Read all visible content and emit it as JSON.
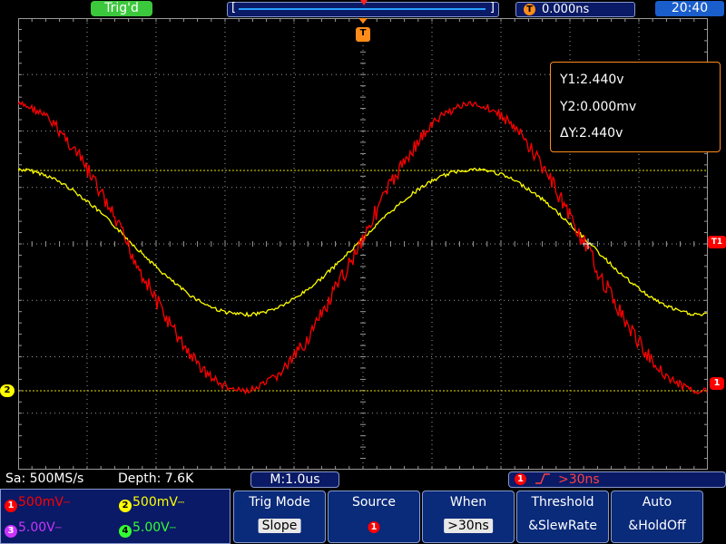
{
  "top": {
    "trigger_status": "Trig'd",
    "trigger_delay": "0.000ns",
    "clock": "20:40"
  },
  "cursor_readout": {
    "y1": "Y1:2.440v",
    "y2": "Y2:0.000mv",
    "dy": "ΔY:2.440v"
  },
  "markers": {
    "trigger_position": "T",
    "ch2": "2",
    "ch1": "1",
    "trigger_level": "T1",
    "delay_icon": "T"
  },
  "status": {
    "sample_rate": "Sa: 500MS/s",
    "depth": "Depth: 7.6K",
    "main_time": "M:1.0us",
    "trigger_channel": "1",
    "trigger_value": ">30ns"
  },
  "channels": [
    {
      "num": "1",
      "scale": "500mV",
      "color": "#ff0000"
    },
    {
      "num": "2",
      "scale": "500mV",
      "color": "#ffff00"
    },
    {
      "num": "3",
      "scale": "5.00V",
      "color": "#cc33ff"
    },
    {
      "num": "4",
      "scale": "5.00V",
      "color": "#33ff33"
    }
  ],
  "menu": [
    {
      "title": "Trig Mode",
      "value": "Slope"
    },
    {
      "title": "Source",
      "value": "1"
    },
    {
      "title": "When",
      "value": ">30ns"
    },
    {
      "title": "Threshold",
      "value": "&SlewRate"
    },
    {
      "title": "Auto",
      "value": "&HoldOff"
    }
  ],
  "icons": {
    "edge": "rising-slope-icon",
    "coupling": "dc-coupling-icon"
  },
  "colors": {
    "ch1_trace": "#ff0000",
    "ch2_trace": "#ffff00",
    "grid": "#808080",
    "accent": "#ff8c1a"
  }
}
